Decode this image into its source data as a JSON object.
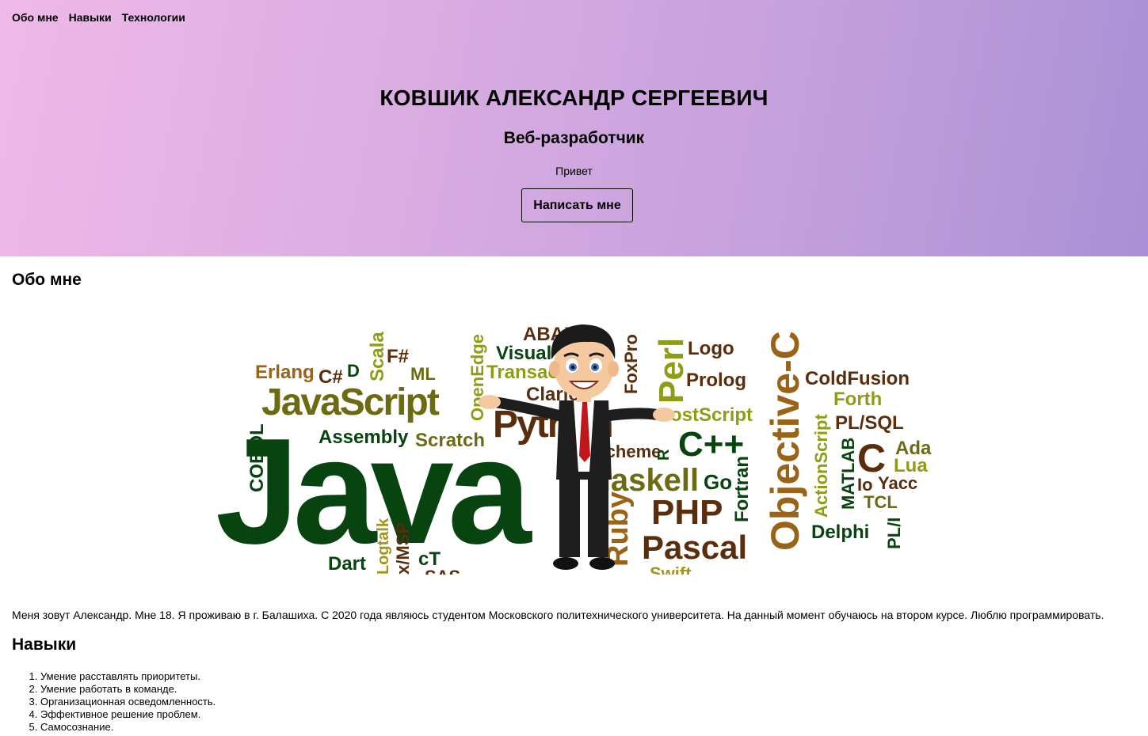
{
  "nav": {
    "items": [
      {
        "label": "Обо мне"
      },
      {
        "label": "Навыки"
      },
      {
        "label": "Технологии"
      }
    ]
  },
  "hero": {
    "title": "КОВШИК АЛЕКСАНДР СЕРГЕЕВИЧ",
    "subtitle": "Веб-разработчик",
    "greeting": "Привет",
    "button_label": "Написать мне"
  },
  "about": {
    "title": "Обо мне",
    "text": "Меня зовут Александр. Мне 18. Я проживаю в г. Балашиха. С 2020 года являюсь студентом Московского политехнического университета. На данный момент обучаюсь на втором курсе. Люблю программировать."
  },
  "wordcloud": {
    "words": [
      "Java",
      "JavaScript",
      "Erlang",
      "C#",
      "D",
      "Scala",
      "F#",
      "ML",
      "OpenEdge",
      "ABAP",
      "Visual",
      "Transact",
      "Clarion",
      "Python",
      "FoxPro",
      "Perl",
      "Logo",
      "Prolog",
      "Objective-C",
      "ColdFusion",
      "Forth",
      "PL/SQL",
      "PostScript",
      "C++",
      "Scheme",
      "R",
      "Haskell",
      "Go",
      "Fortran",
      "ActionScript",
      "MATLAB",
      "C",
      "Ada",
      "Lua",
      "Io",
      "Yacc",
      "TCL",
      "PHP",
      "Delphi",
      "PL/I",
      "Ruby",
      "Pascal",
      "Swift",
      "Assembly",
      "Scratch",
      "COBOL",
      "Dart",
      "x/MSP",
      "cT",
      "SAS",
      "Logtalk"
    ],
    "colors": {
      "dark": "#07440f",
      "olive": "#6c6b12",
      "lime": "#8f9d14",
      "brown": "#5a2d0c",
      "orange": "#9a6315",
      "gold": "#a1951c"
    }
  },
  "skills": {
    "title": "Навыки",
    "items": [
      "Умение расставлять приоритеты.",
      "Умение работать в команде.",
      "Организационная осведомленность.",
      "Эффективное решение проблем.",
      "Самосознание."
    ]
  }
}
